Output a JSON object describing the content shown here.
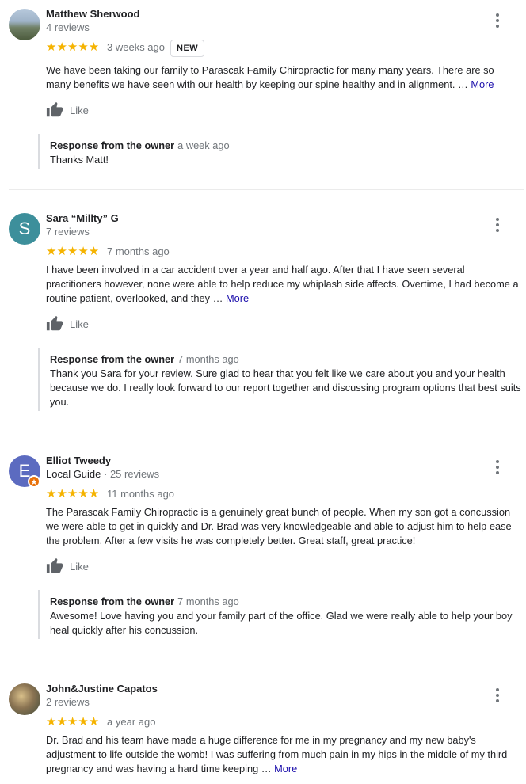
{
  "reviews": [
    {
      "name": "Matthew Sherwood",
      "subtitle": "4 reviews",
      "stars": "★★★★★",
      "ago": "3 weeks ago",
      "badge": "NEW",
      "text": "We have been taking our family to Parascak Family Chiropractic for many many years. There are so many benefits we have seen with our health by keeping our spine healthy and in alignment. …",
      "more": "More",
      "like": "Like",
      "response": {
        "label": "Response from the owner",
        "ago": "a week ago",
        "text": "Thanks Matt!"
      }
    },
    {
      "name": "Sara “Millty” G",
      "avatar_letter": "S",
      "subtitle": "7 reviews",
      "stars": "★★★★★",
      "ago": "7 months ago",
      "text": "I have been involved in a car accident over a year and half ago. After that I have seen several practitioners however, none were able to help reduce my whiplash side affects. Overtime, I had  become a routine patient, overlooked,  and they …",
      "more": "More",
      "like": "Like",
      "response": {
        "label": "Response from the owner",
        "ago": "7 months ago",
        "text": "Thank you Sara for your review. Sure glad to hear that you felt like we care about you and your health because we do. I really look forward to our report together and discussing program options that best suits you."
      }
    },
    {
      "name": "Elliot Tweedy",
      "avatar_letter": "E",
      "local_guide": "Local Guide",
      "subtitle": " · 25 reviews",
      "stars": "★★★★★",
      "ago": "11 months ago",
      "text": "The Parascak Family Chiropractic is a genuinely great bunch of people. When my son got a concussion we were able to get in quickly and Dr. Brad was very knowledgeable and able to adjust him to help ease the problem. After a few visits he was completely better. Great staff, great practice!",
      "like": "Like",
      "response": {
        "label": "Response from the owner",
        "ago": "7 months ago",
        "text": "Awesome! Love having you and your family part of the office. Glad we were really able to help your boy heal quickly after his concussion."
      }
    },
    {
      "name": "John&Justine Capatos",
      "subtitle": "2 reviews",
      "stars": "★★★★★",
      "ago": "a year ago",
      "text": "Dr. Brad and his team have made a huge difference for me in my pregnancy and my new baby's adjustment to life outside the womb! I was suffering from much pain in my hips in the middle of my third pregnancy and was having a hard time keeping …",
      "more": "More"
    }
  ],
  "colors": {
    "star": "#f5b300",
    "link": "#1a0dab",
    "avatar_s": "#3d8f9b",
    "avatar_e": "#5c6bc0",
    "local_guide_badge": "#e8710a"
  }
}
